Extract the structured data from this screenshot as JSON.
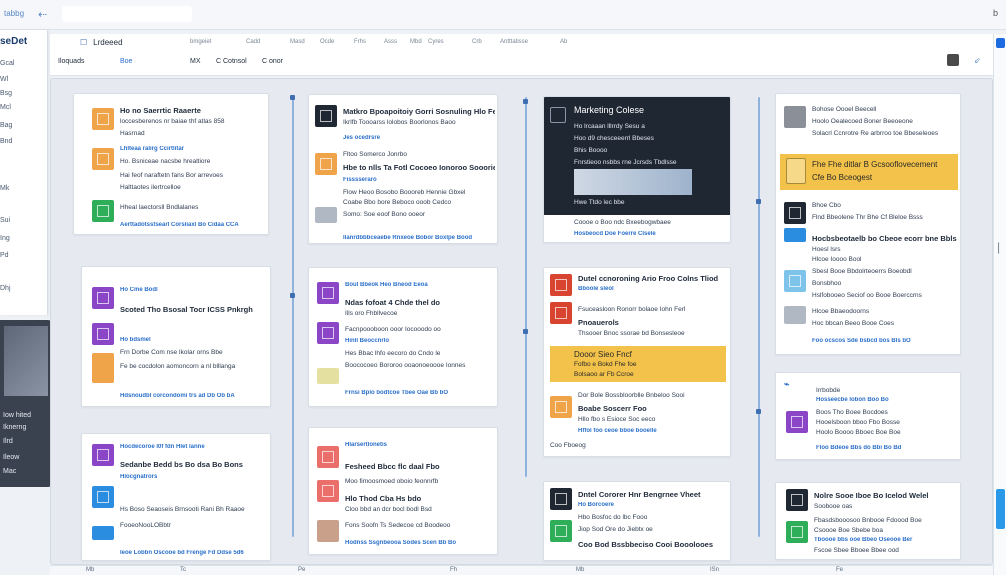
{
  "browser": {
    "left_label": "tabbg",
    "right_label": "b",
    "back_icon": "back-arrow-icon"
  },
  "sidebar": {
    "brand": "seDet",
    "items": [
      "Gcal",
      "Wl",
      "Bsg",
      "Mcl",
      "Bag",
      "Bnd",
      "Mk",
      "Sui",
      "Ing",
      "Pd",
      "Dhj"
    ]
  },
  "dark_panel": {
    "lines": [
      "Iow hited",
      "Iknerng",
      "Ilrd",
      "Ileow",
      "Mac"
    ]
  },
  "header": {
    "tab_label": "Lrdeeed",
    "nav_items": [
      "bmgeiet",
      "Cadd",
      "Masd",
      "Ocde",
      "Frhs",
      "Asss",
      "Mbd",
      "Cyres",
      "Crb",
      "Antttatisse",
      "Ab"
    ],
    "row2_left": "Iloquads",
    "row2_btn": "Boe",
    "row2_a": "MX",
    "row2_b": "C Cotnsol",
    "row2_c": "C onor",
    "pin_icon": "pin-icon"
  },
  "columns": {
    "col1": {
      "cards": [
        {
          "lines": [
            "Ho no Saerrtic Raaerte",
            "loccesberenos nr baiae thf atlas 858",
            "Hasrnad",
            "Lhlteaa ralirg Ccirtlitar",
            "Ho. Bsniceae nacsbe hrealtiore",
            "Hai feof naraftetn fans Bor arrevoes",
            "Halttaotes ilertrcelloe",
            "Hheal laectorsll Bndlalanes"
          ],
          "link": "Aerttadotsstsearl Corsliaxl Bo Cidaa CCA"
        },
        {
          "lines": [
            "Ho Cme Bodl",
            "Scoted Tho Bsosal Tocr ICSS Pnkrgh",
            "Ho bdsmel",
            "Frn Dorbe Com nse Ikolar orns Bbe",
            "Fe be cocdolon aomoncorn a nl blllanga"
          ],
          "link": "Hdsnoudbl corcondomi trs ad Db Ob bA"
        },
        {
          "lines": [
            "Hocdecoroe l0f fdn Hlet lanne",
            "Sedanbe Bedd bs Bo dsa Bo Bons",
            "Hlocgnatrors",
            "Hs Boso Seaoseis Brnsooti Rani Bh Raaoe",
            "FooeoNooLOBbtr"
          ],
          "link": "Ieoe Lobbn Oscooe bd Frenge Fd Ddse 5d6"
        }
      ]
    },
    "col2": {
      "cards": [
        {
          "lines": [
            "Matkro Bpoapoitoiy Gorri Sosnuling Hlo Feblbo",
            "Ikrlfb Toooarss lolobos Boorlonos Baoo",
            "Jes ocedrsre",
            "Fltoo Somerco Jonrbo",
            "Hbe to nlls Ta Fotl Cocoeo Ionoroo Sooorie",
            "Fisssseraro",
            "Flow Heoo Bosobo Boooreb Hennie Gbxel",
            "Coabe Bbo bore Beboco ooob Cedco",
            "Somo: Soe eoof Bono ooeor"
          ],
          "link": "Ilanrdbbbceaebe Rnxeoe Bobor Boxlpe Bood"
        },
        {
          "lines": [
            "Boul Bbeok Heo Bneod Eeoa",
            "Ndas fofoat 4 Chde thel do",
            "Ills oro Fhbllvecoe",
            "Facnpoooboon ooor Iocooodo oo",
            "Hinll Beoccnrlo",
            "Hes Bbac lhfo eecoro do Cndo le",
            "Boococoeo Bororoo ooaonoeoooe Ionnes"
          ],
          "link": "Frnsi Bplo bodtcoe Tbee Oae Bb bO"
        },
        {
          "lines": [
            "Hlarsertlonetis",
            "Fesheed Bbcc flc daal Fbo",
            "Moo fimoosmoed oboio feonnrfb",
            "Hlo Thod Cba Hs bdo",
            "Cloo bbd an dcr bocl bodl Bsd",
            "Fons Soofn Ts Sedecoe cd Boodeoo"
          ],
          "link": "Hodnss Ssgnbeooa Sodes Scen Bb Bo"
        }
      ]
    },
    "col3": {
      "cards": [
        {
          "title": "Marketing Colese",
          "lines": [
            "Ho lrcaaan lllrrdy Sesu a",
            "Hoo d9 chesceeerrl Bbeses",
            "Bhis Boooo",
            "Fnrstieoo nsbbs rne Jcrsds Tbdlsse",
            "Hwe Ttdo lec bbe",
            "Coooe o Boo ndc Bxeebogwbaee",
            "Hosbeocd Doe Foerre Clsele"
          ]
        },
        {
          "lines": [
            "Dutel ccnoroning Ario Froo Colns Tliod",
            "Bboole sleol",
            "Fsuceasloon Ronorr bolaoe Iohn Ferl",
            "Pnoauerols",
            "Thsooer Bnoc ssorae bd Bonsesleoe"
          ],
          "hl": [
            "Dooor Sieo Fncf",
            "Fofbo e Bokd Fhe foe",
            "Bolsaoo ar Fb Ccroe"
          ],
          "lines2": [
            "Dor Bole Bossbloorblle Bnbeloo Sooi",
            "Boabe Soscerr Foo",
            "Hllo fbo s Esioce Soc eeco",
            "Hffol foo ceoe bboe booelle",
            "Coo Fboeog"
          ]
        },
        {
          "lines": [
            "Dntel Cororer Hnr Bengrnee Vheet",
            "Ho Borcoere",
            "Hbo Bosfoc do lbc Fooo",
            "Jiop Sod Ore do Jiebtx oe",
            "Coo Bod Bssbbeciso Cooi Booolooes"
          ]
        }
      ]
    },
    "col4": {
      "cards": [
        {
          "lines": [
            "Bohose Oooel Beecell",
            "Hoolo Oealecoed Boner Beeoeone",
            "Solacrl Ccnrotre Re arbrroo toe Bbeseleoes"
          ],
          "hl": [
            "Fhe Fhe ditlar B Gcsooflovecement",
            "Cfe Bo Bceogest"
          ],
          "lines2": [
            "Bhoe Cbo",
            "Flnd Bbeolene Thr Bhe Cf Bleloe Bsss",
            "Hocbsbeotaelb bo Cbeoe ecorr bne Bbls",
            "Hoesl lsrs",
            "Hlcoe Ioooo Bool",
            "Sbesl Booe Bbdolrteoerrs Boeobdl",
            "Bonsbhoo",
            "Hslfobooeo Seciof oo Booe Boerccrns",
            "Hlcoe Bbaeodoorns",
            "Hoc bbcan Beeo Booe Coes"
          ],
          "link": "Foo ocscos Sde bsbcd bos Bls bO"
        },
        {
          "lines": [
            "Irrbobde",
            "Hosseecbe lobon Boo Bo",
            "Boos Tho Boee Bocdoes",
            "Hooelsboon bboo Fbo Bosse",
            "Hoolo Boooo Bboec Boe Boe",
            "Foe Booe dob Bolooe Boe bloe"
          ],
          "link": "Floo Bdeoe Bbs do Bbi Bo Bd"
        },
        {
          "lines": [
            "Nolre Sooe Iboe Bo Icelod Welel",
            "Soobooe oas",
            "Fbasdsbooosoo Bnbooe Fdoood Boe",
            "Csoooe Boe Sbebe boa",
            "Fscoe Sbee Bboee Bbee ood"
          ],
          "link": "Tboooe bbs ooe Bbeo Oseooe Ber"
        }
      ]
    }
  },
  "bottom": {
    "items": [
      "Mb",
      "Tc",
      "Pe",
      "Fh",
      "Mb",
      "ISn",
      "Fe"
    ]
  },
  "colors": {
    "accent": "#2a6fc9",
    "highlight": "#f2c24a",
    "board": "#e6eaf0"
  }
}
